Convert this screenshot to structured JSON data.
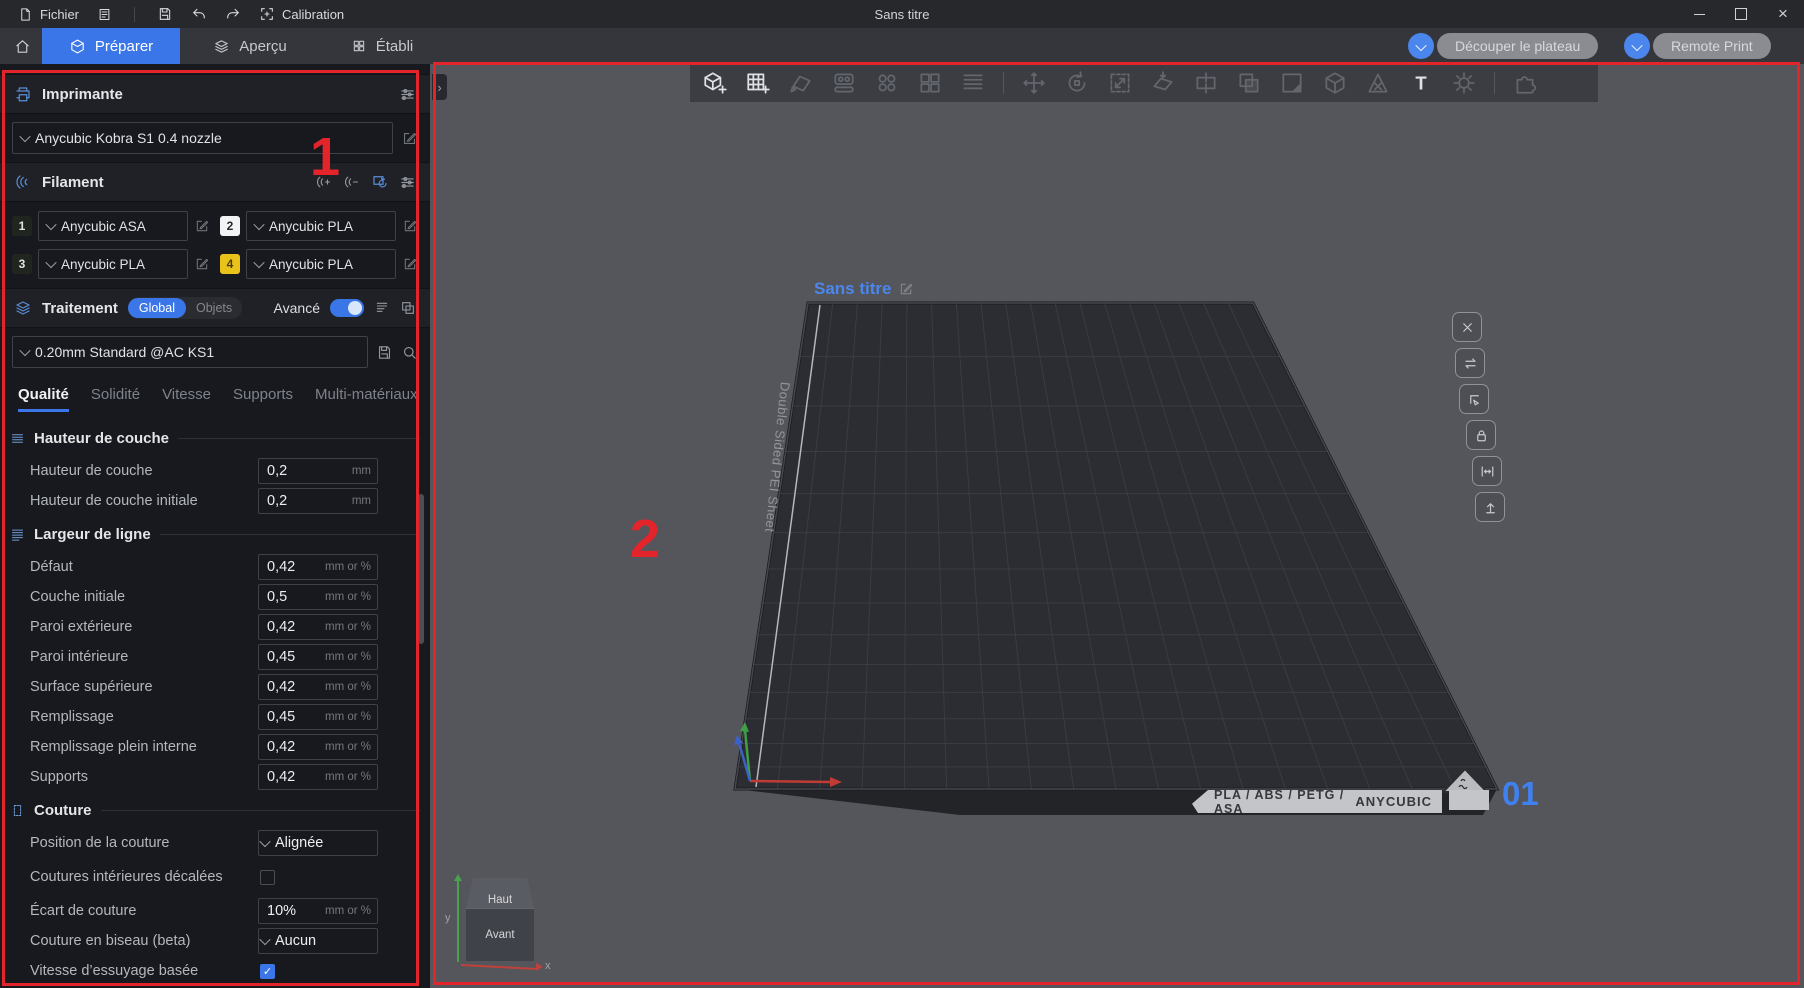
{
  "titlebar": {
    "file_menu": "Fichier",
    "calibration": "Calibration",
    "window_title": "Sans titre",
    "minimize_glyph": "─",
    "close_glyph": "×"
  },
  "tabbar": {
    "tabs": [
      {
        "label": "Préparer",
        "active": true
      },
      {
        "label": "Aperçu",
        "active": false
      },
      {
        "label": "Établi",
        "active": false
      }
    ],
    "slice_button": "Découper le plateau",
    "remote_print_button": "Remote Print"
  },
  "sidebar": {
    "printer": {
      "title": "Imprimante",
      "selected": "Anycubic Kobra S1 0.4 nozzle"
    },
    "filament": {
      "title": "Filament",
      "slots": [
        {
          "id": "1",
          "name": "Anycubic ASA",
          "badge_color": "#20261f"
        },
        {
          "id": "2",
          "name": "Anycubic PLA",
          "badge_color": "#f2f3f4"
        },
        {
          "id": "3",
          "name": "Anycubic PLA",
          "badge_color": "#20261f"
        },
        {
          "id": "4",
          "name": "Anycubic PLA",
          "badge_color": "#e9c319"
        }
      ]
    },
    "process": {
      "title": "Traitement",
      "scope_global": "Global",
      "scope_objects": "Objets",
      "active_scope": "Global",
      "advanced_label": "Avancé",
      "advanced_on": true,
      "preset": "0.20mm Standard @AC KS1"
    },
    "tabs": [
      "Qualité",
      "Solidité",
      "Vitesse",
      "Supports",
      "Multi-matériaux"
    ],
    "active_tab": "Qualité",
    "groups": [
      {
        "title": "Hauteur de couche",
        "rows": [
          {
            "label": "Hauteur de couche",
            "value": "0,2",
            "unit": "mm",
            "type": "input"
          },
          {
            "label": "Hauteur de couche initiale",
            "value": "0,2",
            "unit": "mm",
            "type": "input"
          }
        ]
      },
      {
        "title": "Largeur de ligne",
        "rows": [
          {
            "label": "Défaut",
            "value": "0,42",
            "unit": "mm or %",
            "type": "input"
          },
          {
            "label": "Couche initiale",
            "value": "0,5",
            "unit": "mm or %",
            "type": "input"
          },
          {
            "label": "Paroi extérieure",
            "value": "0,42",
            "unit": "mm or %",
            "type": "input"
          },
          {
            "label": "Paroi intérieure",
            "value": "0,45",
            "unit": "mm or %",
            "type": "input"
          },
          {
            "label": "Surface supérieure",
            "value": "0,42",
            "unit": "mm or %",
            "type": "input"
          },
          {
            "label": "Remplissage",
            "value": "0,45",
            "unit": "mm or %",
            "type": "input"
          },
          {
            "label": "Remplissage plein interne",
            "value": "0,42",
            "unit": "mm or %",
            "type": "input"
          },
          {
            "label": "Supports",
            "value": "0,42",
            "unit": "mm or %",
            "type": "input"
          }
        ]
      },
      {
        "title": "Couture",
        "rows": [
          {
            "label": "Position de la couture",
            "value": "Alignée",
            "type": "select"
          },
          {
            "label": "Coutures intérieures décalées",
            "type": "checkbox",
            "checked": false
          },
          {
            "label": "Écart de couture",
            "value": "10%",
            "unit": "mm or %",
            "type": "input"
          },
          {
            "label": "Couture en biseau (beta)",
            "value": "Aucun",
            "type": "select"
          },
          {
            "label": "Vitesse d’essuyage basée",
            "type": "checkbox",
            "checked": true
          }
        ]
      }
    ]
  },
  "viewport": {
    "plate_name": "Sans titre",
    "plate_sheet_label": "Double Sided PEI Sheet",
    "plate_materials": "PLA / ABS / PETG / ASA",
    "plate_brand": "ANYCUBIC",
    "plate_number": "01",
    "nav_cube": {
      "top": "Haut",
      "front": "Avant",
      "axis_x": "x",
      "axis_y": "y"
    }
  },
  "annotations": {
    "region1_number": "1",
    "region2_number": "2",
    "color": "#e3242b"
  },
  "colors": {
    "accent_blue": "#3a76e8",
    "active_tab": "#3a76e8",
    "viewport_bg": "#55565b",
    "sidebar_bg": "#17191e",
    "titlebar_bg": "#26282c",
    "plate_surface": "#2b2d33",
    "plate_grid_line": "#3a3c43",
    "plate_number_blue": "#3f82ef",
    "filament_badge_1": "#20261f",
    "filament_badge_2": "#f2f3f4",
    "filament_badge_4": "#e9c319",
    "annotation_red": "#e3242b"
  },
  "icons": {
    "titlebar": [
      "file-icon",
      "notes-icon",
      "save-icon",
      "undo-icon",
      "redo-icon",
      "calibration-icon"
    ],
    "toolbar": [
      "add-object-icon",
      "add-plate-icon",
      "auto-orient-icon",
      "arrange-icon",
      "fill-plate-icon",
      "split-objects-icon",
      "layers-list-icon",
      "move-icon",
      "rotate-icon",
      "scale-icon",
      "place-on-face-icon",
      "cut-icon",
      "boolean-icon",
      "color-paint-icon",
      "solid-cube-icon",
      "support-paint-icon",
      "text-tool-icon",
      "seam-tool-icon",
      "assembly-icon"
    ]
  }
}
